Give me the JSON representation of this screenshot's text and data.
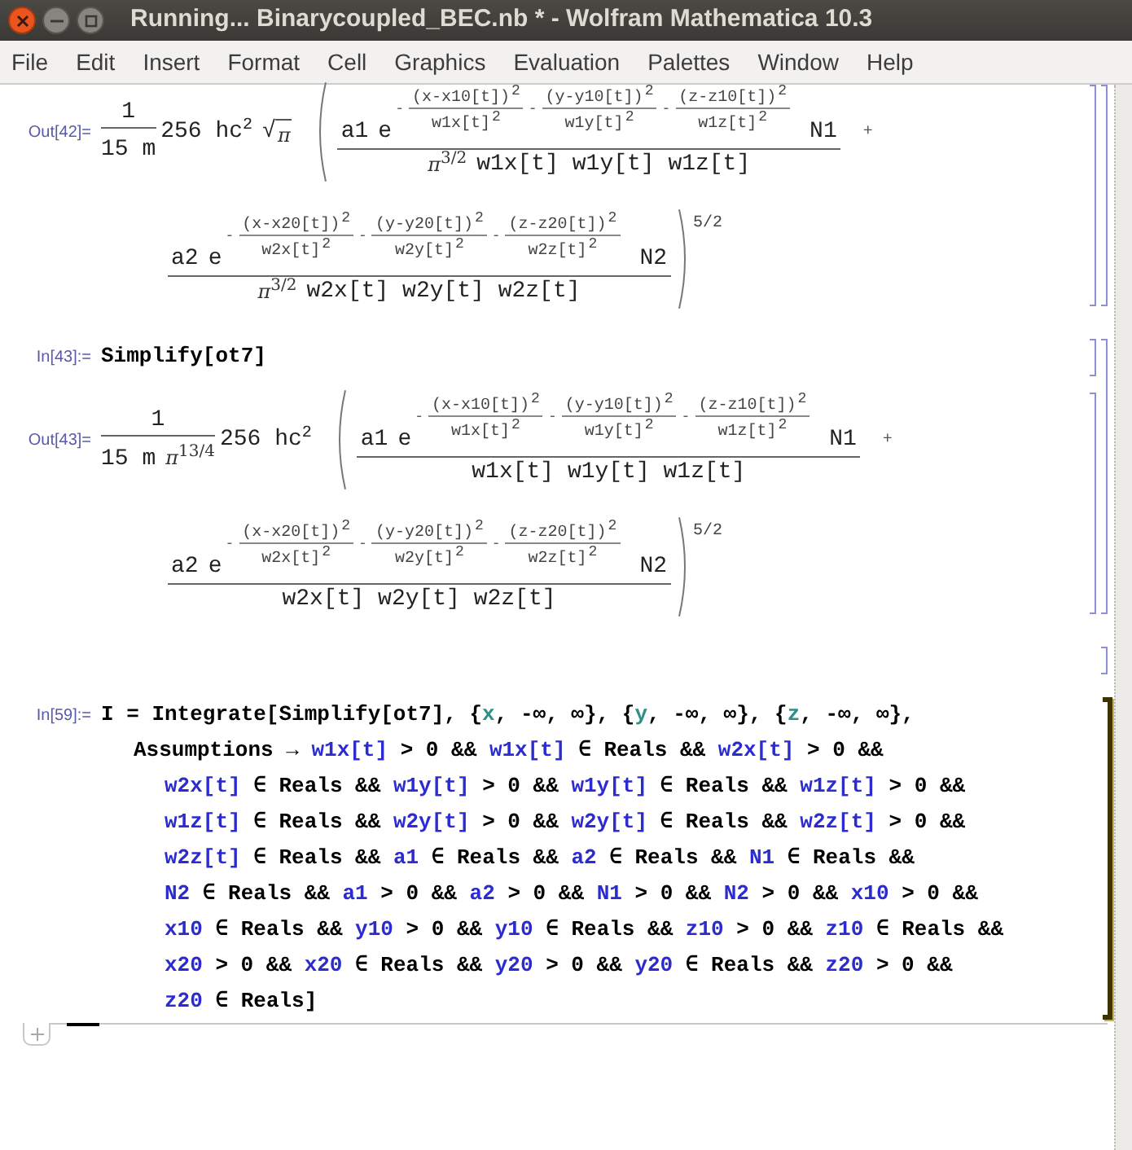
{
  "window": {
    "title": "Running... Binarycoupled_BEC.nb * - Wolfram Mathematica 10.3"
  },
  "menu": [
    "File",
    "Edit",
    "Insert",
    "Format",
    "Cell",
    "Graphics",
    "Evaluation",
    "Palettes",
    "Window",
    "Help"
  ],
  "cells": [
    {
      "kind": "group",
      "cells": [
        {
          "kind": "output",
          "label": "Out[42]=",
          "prefactor": {
            "num": "1",
            "den": "15 m"
          },
          "coefficient": {
            "text": "256 hc",
            "pow": "2"
          },
          "sqrt": {
            "sign": "√",
            "radicand": "π"
          },
          "plus": "+",
          "power": "5/2",
          "terms": [
            {
              "coef": "a1",
              "base": "e",
              "factor": "N1",
              "den_pi": "π",
              "den_pi_pow": "3/2",
              "den": "w1x[t] w1y[t] w1z[t]",
              "exponent": [
                {
                  "sign": "-",
                  "num": "(x-x10[t])",
                  "num_pow": "2",
                  "den": "w1x[t]",
                  "den_pow": "2"
                },
                {
                  "sign": "-",
                  "num": "(y-y10[t])",
                  "num_pow": "2",
                  "den": "w1y[t]",
                  "den_pow": "2"
                },
                {
                  "sign": "-",
                  "num": "(z-z10[t])",
                  "num_pow": "2",
                  "den": "w1z[t]",
                  "den_pow": "2"
                }
              ]
            },
            {
              "coef": "a2",
              "base": "e",
              "factor": "N2",
              "den_pi": "π",
              "den_pi_pow": "3/2",
              "den": "w2x[t] w2y[t] w2z[t]",
              "exponent": [
                {
                  "sign": "-",
                  "num": "(x-x20[t])",
                  "num_pow": "2",
                  "den": "w2x[t]",
                  "den_pow": "2"
                },
                {
                  "sign": "-",
                  "num": "(y-y20[t])",
                  "num_pow": "2",
                  "den": "w2y[t]",
                  "den_pow": "2"
                },
                {
                  "sign": "-",
                  "num": "(z-z20[t])",
                  "num_pow": "2",
                  "den": "w2z[t]",
                  "den_pow": "2"
                }
              ]
            }
          ]
        }
      ]
    },
    {
      "kind": "group",
      "cells": [
        {
          "kind": "input",
          "label": "In[43]:=",
          "evaluating": false,
          "lines": [
            [
              {
                "kind": "plain",
                "text": "Simplify[ot7]"
              }
            ]
          ]
        },
        {
          "kind": "output",
          "label": "Out[43]=",
          "prefactor": {
            "num": "1",
            "den": "15 m",
            "den_pi": "π",
            "den_pi_pow": "13/4"
          },
          "coefficient": {
            "text": "256 hc",
            "pow": "2"
          },
          "plus": "+",
          "power": "5/2",
          "terms": [
            {
              "coef": "a1",
              "base": "e",
              "factor": "N1",
              "den": "w1x[t] w1y[t] w1z[t]",
              "exponent": [
                {
                  "sign": "-",
                  "num": "(x-x10[t])",
                  "num_pow": "2",
                  "den": "w1x[t]",
                  "den_pow": "2"
                },
                {
                  "sign": "-",
                  "num": "(y-y10[t])",
                  "num_pow": "2",
                  "den": "w1y[t]",
                  "den_pow": "2"
                },
                {
                  "sign": "-",
                  "num": "(z-z10[t])",
                  "num_pow": "2",
                  "den": "w1z[t]",
                  "den_pow": "2"
                }
              ]
            },
            {
              "coef": "a2",
              "base": "e",
              "factor": "N2",
              "den": "w2x[t] w2y[t] w2z[t]",
              "exponent": [
                {
                  "sign": "-",
                  "num": "(x-x20[t])",
                  "num_pow": "2",
                  "den": "w2x[t]",
                  "den_pow": "2"
                },
                {
                  "sign": "-",
                  "num": "(y-y20[t])",
                  "num_pow": "2",
                  "den": "w2y[t]",
                  "den_pow": "2"
                },
                {
                  "sign": "-",
                  "num": "(z-z20[t])",
                  "num_pow": "2",
                  "den": "w2z[t]",
                  "den_pow": "2"
                }
              ]
            }
          ]
        }
      ]
    },
    {
      "kind": "empty"
    },
    {
      "kind": "input",
      "label": "In[59]:=",
      "evaluating": true,
      "lines": [
        [
          {
            "kind": "plain",
            "text": "I = Integrate[Simplify[ot7], {"
          },
          {
            "kind": "local",
            "text": "x"
          },
          {
            "kind": "plain",
            "text": ", -∞, ∞}, {"
          },
          {
            "kind": "local",
            "text": "y"
          },
          {
            "kind": "plain",
            "text": ", -∞, ∞}, {"
          },
          {
            "kind": "local",
            "text": "z"
          },
          {
            "kind": "plain",
            "text": ", -∞, ∞},"
          }
        ],
        [
          {
            "kind": "plain",
            "text": "Assumptions → "
          },
          {
            "kind": "sym",
            "text": "w1x[t]"
          },
          {
            "kind": "plain",
            "text": " > 0 && "
          },
          {
            "kind": "sym",
            "text": "w1x[t]"
          },
          {
            "kind": "plain",
            "text": " ∈ Reals && "
          },
          {
            "kind": "sym",
            "text": "w2x[t]"
          },
          {
            "kind": "plain",
            "text": " > 0 &&"
          }
        ],
        [
          {
            "kind": "sym",
            "text": "w2x[t]"
          },
          {
            "kind": "plain",
            "text": " ∈ Reals && "
          },
          {
            "kind": "sym",
            "text": "w1y[t]"
          },
          {
            "kind": "plain",
            "text": " > 0 && "
          },
          {
            "kind": "sym",
            "text": "w1y[t]"
          },
          {
            "kind": "plain",
            "text": " ∈ Reals && "
          },
          {
            "kind": "sym",
            "text": "w1z[t]"
          },
          {
            "kind": "plain",
            "text": " > 0 &&"
          }
        ],
        [
          {
            "kind": "sym",
            "text": "w1z[t]"
          },
          {
            "kind": "plain",
            "text": " ∈ Reals && "
          },
          {
            "kind": "sym",
            "text": "w2y[t]"
          },
          {
            "kind": "plain",
            "text": " > 0 && "
          },
          {
            "kind": "sym",
            "text": "w2y[t]"
          },
          {
            "kind": "plain",
            "text": " ∈ Reals && "
          },
          {
            "kind": "sym",
            "text": "w2z[t]"
          },
          {
            "kind": "plain",
            "text": " > 0 &&"
          }
        ],
        [
          {
            "kind": "sym",
            "text": "w2z[t]"
          },
          {
            "kind": "plain",
            "text": " ∈ Reals && "
          },
          {
            "kind": "sym",
            "text": "a1"
          },
          {
            "kind": "plain",
            "text": " ∈ Reals && "
          },
          {
            "kind": "sym",
            "text": "a2"
          },
          {
            "kind": "plain",
            "text": " ∈ Reals && "
          },
          {
            "kind": "sym",
            "text": "N1"
          },
          {
            "kind": "plain",
            "text": " ∈ Reals &&"
          }
        ],
        [
          {
            "kind": "sym",
            "text": "N2"
          },
          {
            "kind": "plain",
            "text": " ∈ Reals && "
          },
          {
            "kind": "sym",
            "text": "a1"
          },
          {
            "kind": "plain",
            "text": " > 0 && "
          },
          {
            "kind": "sym",
            "text": "a2"
          },
          {
            "kind": "plain",
            "text": " > 0 && "
          },
          {
            "kind": "sym",
            "text": "N1"
          },
          {
            "kind": "plain",
            "text": " > 0 && "
          },
          {
            "kind": "sym",
            "text": "N2"
          },
          {
            "kind": "plain",
            "text": " > 0 && "
          },
          {
            "kind": "sym",
            "text": "x10"
          },
          {
            "kind": "plain",
            "text": " > 0 &&"
          }
        ],
        [
          {
            "kind": "sym",
            "text": "x10"
          },
          {
            "kind": "plain",
            "text": " ∈ Reals && "
          },
          {
            "kind": "sym",
            "text": "y10"
          },
          {
            "kind": "plain",
            "text": " > 0 && "
          },
          {
            "kind": "sym",
            "text": "y10"
          },
          {
            "kind": "plain",
            "text": " ∈ Reals && "
          },
          {
            "kind": "sym",
            "text": "z10"
          },
          {
            "kind": "plain",
            "text": " > 0 && "
          },
          {
            "kind": "sym",
            "text": "z10"
          },
          {
            "kind": "plain",
            "text": " ∈ Reals &&"
          }
        ],
        [
          {
            "kind": "sym",
            "text": "x20"
          },
          {
            "kind": "plain",
            "text": " > 0 && "
          },
          {
            "kind": "sym",
            "text": "x20"
          },
          {
            "kind": "plain",
            "text": " ∈ Reals && "
          },
          {
            "kind": "sym",
            "text": "y20"
          },
          {
            "kind": "plain",
            "text": " > 0 && "
          },
          {
            "kind": "sym",
            "text": "y20"
          },
          {
            "kind": "plain",
            "text": " ∈ Reals && "
          },
          {
            "kind": "sym",
            "text": "z20"
          },
          {
            "kind": "plain",
            "text": " > 0 &&"
          }
        ],
        [
          {
            "kind": "sym",
            "text": "z20"
          },
          {
            "kind": "plain",
            "text": " ∈ Reals]"
          }
        ]
      ]
    }
  ]
}
